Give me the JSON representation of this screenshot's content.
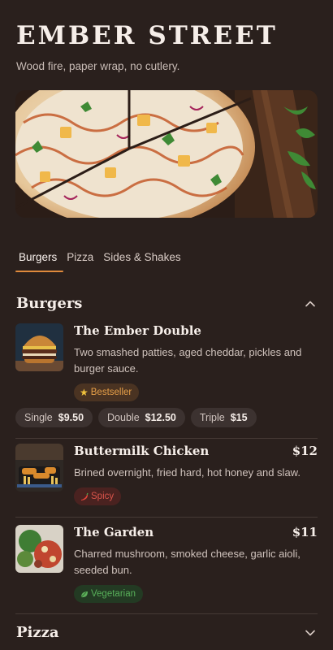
{
  "header": {
    "brand": "EMBER STREET",
    "tagline": "Wood fire, paper wrap, no cutlery."
  },
  "tabs": [
    {
      "label": "Burgers"
    },
    {
      "label": "Pizza"
    },
    {
      "label": "Sides & Shakes"
    }
  ],
  "sections": {
    "burgers": {
      "title": "Burgers"
    },
    "pizza": {
      "title": "Pizza"
    }
  },
  "items": [
    {
      "name": "The Ember Double",
      "description": "Two smashed patties, aged cheddar, pickles and burger sauce.",
      "badge": "Bestseller",
      "sizes": [
        {
          "label": "Single",
          "price": "$9.50"
        },
        {
          "label": "Double",
          "price": "$12.50"
        },
        {
          "label": "Triple",
          "price": "$15"
        }
      ]
    },
    {
      "name": "Buttermilk Chicken",
      "price": "$12",
      "description": "Brined overnight, fried hard, hot honey and slaw.",
      "badge": "Spicy"
    },
    {
      "name": "The Garden",
      "price": "$11",
      "description": "Charred mushroom, smoked cheese, garlic aioli, seeded bun.",
      "badge": "Vegetarian"
    }
  ],
  "colors": {
    "background": "#2a201d",
    "accent": "#e08a3c",
    "bestseller": "#e7a049",
    "spicy": "#d9544a",
    "vegetarian": "#58b05a"
  },
  "icons": {
    "burgers_toggle": "chevron-up-icon",
    "pizza_toggle": "chevron-down-icon",
    "bestseller": "star-icon",
    "spicy": "chili-icon",
    "vegetarian": "leaf-icon"
  }
}
